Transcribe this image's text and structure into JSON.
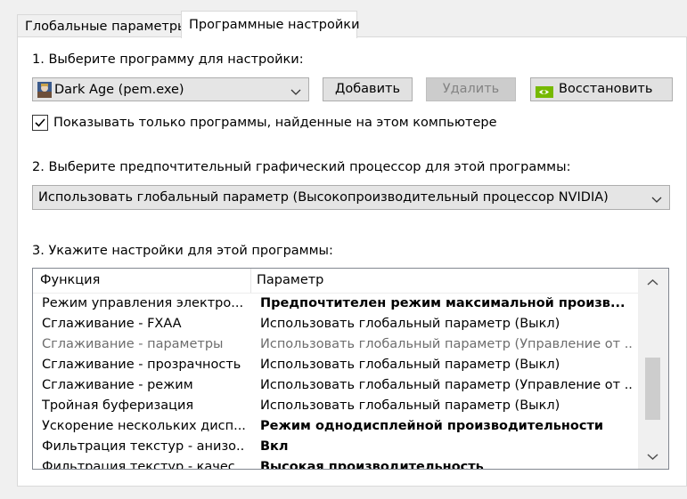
{
  "tabs": [
    {
      "label": "Глобальные параметры"
    },
    {
      "label": "Программные настройки"
    }
  ],
  "step1": {
    "label": "1. Выберите программу для настройки:",
    "selected_program": "Dark Age (pem.exe)",
    "add_button": "Добавить",
    "remove_button": "Удалить",
    "restore_button": "Восстановить",
    "show_only_label": "Показывать только программы, найденные на этом компьютере",
    "show_only_checked": true
  },
  "step2": {
    "label": "2. Выберите предпочтительный графический процессор для этой программы:",
    "selected_gpu": "Использовать глобальный параметр (Высокопроизводительный процессор NVIDIA)"
  },
  "step3": {
    "label": "3. Укажите настройки для этой программы:",
    "columns": [
      "Функция",
      "Параметр"
    ],
    "rows": [
      {
        "feature": "Режим управления электро...",
        "value": "Предпочтителен режим максимальной произв...",
        "style": "bold"
      },
      {
        "feature": "Сглаживание - FXAA",
        "value": "Использовать глобальный параметр (Выкл)",
        "style": "normal"
      },
      {
        "feature": "Сглаживание - параметры",
        "value": "Использовать глобальный параметр (Управление от ...",
        "style": "dim"
      },
      {
        "feature": "Сглаживание - прозрачность",
        "value": "Использовать глобальный параметр (Выкл)",
        "style": "normal"
      },
      {
        "feature": "Сглаживание - режим",
        "value": "Использовать глобальный параметр (Управление от ...",
        "style": "normal"
      },
      {
        "feature": "Тройная буферизация",
        "value": "Использовать глобальный параметр (Выкл)",
        "style": "normal"
      },
      {
        "feature": "Ускорение нескольких дисп...",
        "value": "Режим однодисплейной производительности",
        "style": "bold"
      },
      {
        "feature": "Фильтрация текстур - анизо...",
        "value": "Вкл",
        "style": "bold"
      },
      {
        "feature": "Фильтрация текстур - качес...",
        "value": "Высокая производительность",
        "style": "bold"
      }
    ]
  },
  "icons": {
    "program_icon": "game-app-icon",
    "restore_icon": "nvidia-logo-icon",
    "dropdown": "chevron-down-icon"
  },
  "colors": {
    "accent": "#0078d7",
    "nvidia_green": "#76b900"
  }
}
